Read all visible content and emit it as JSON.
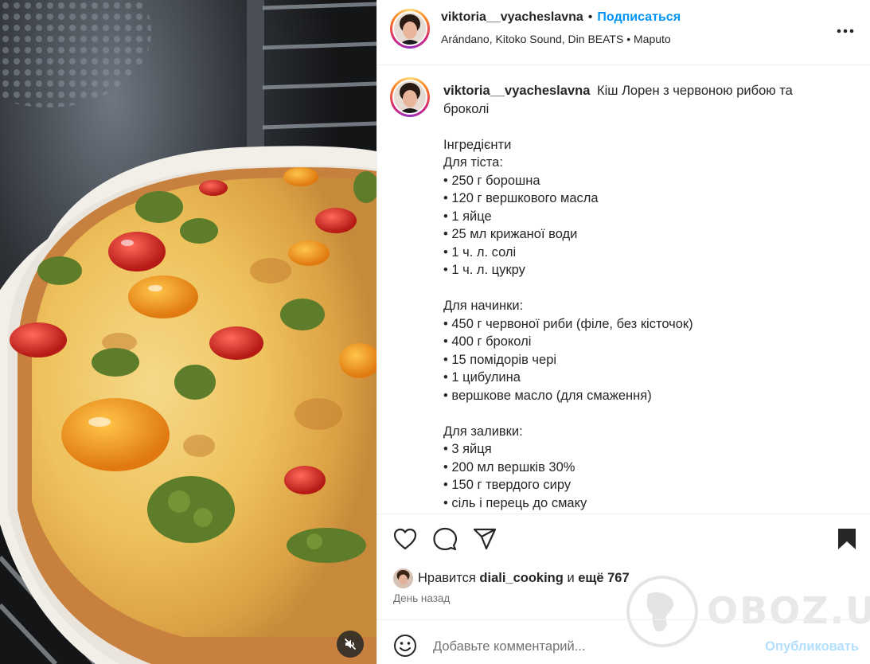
{
  "post": {
    "username": "viktoria__vyacheslavna",
    "separator": "•",
    "follow_label": "Подписаться",
    "audio_line": "Arándano, Kitoko Sound, Din BEATS • Maputo",
    "more_icon": "more-horizontal-icon"
  },
  "caption": {
    "username": "viktoria__vyacheslavna",
    "title": "Кіш Лорен з червоною рибою та броколі",
    "sections": [
      {
        "lines": [
          "Інгредієнти",
          "Для тіста:",
          "• 250 г борошна",
          "• 120 г вершкового масла",
          "• 1 яйце",
          "• 25 мл крижаної води",
          "• 1 ч. л. солі",
          "• 1 ч. л. цукру"
        ]
      },
      {
        "lines": [
          "Для начинки:",
          "• 450 г червоної риби (філе, без кісточок)",
          "• 400 г броколі",
          "• 15 помідорів чері",
          "• 1 цибулина",
          "• вершкове масло (для смаження)"
        ]
      },
      {
        "lines": [
          "Для заливки:",
          "• 3 яйця",
          "• 200 мл вершків 30%",
          "• 150 г твердого сиру",
          "• сіль і перець до смаку"
        ]
      }
    ]
  },
  "actions": {
    "like_icon": "heart-icon",
    "comment_icon": "comment-icon",
    "share_icon": "share-icon",
    "save_icon": "bookmark-icon"
  },
  "likes": {
    "prefix": "Нравится",
    "user": "diali_cooking",
    "joiner": "и",
    "more": "ещё 767"
  },
  "time": "День назад",
  "comment": {
    "placeholder": "Добавьте комментарий...",
    "post_label": "Опубликовать",
    "emoji_icon": "emoji-icon"
  },
  "media": {
    "mute_icon": "muted-speaker-icon"
  },
  "watermark": {
    "text": "OBOZ.UA"
  },
  "colors": {
    "accent": "#0095f6",
    "post_disabled": "#b2dffc",
    "secondary_text": "#737373"
  }
}
